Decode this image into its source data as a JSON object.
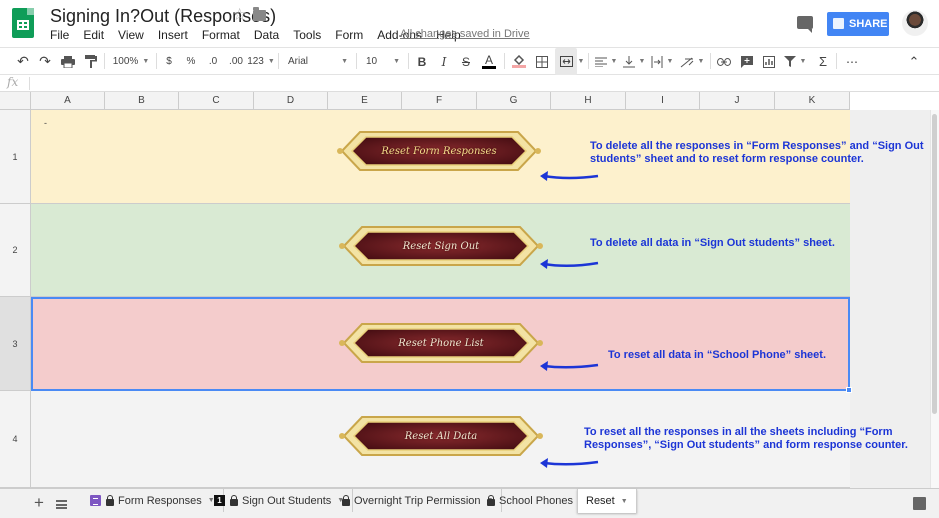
{
  "app": {
    "title": "Signing In?Out (Responses)",
    "saved_status": "All changes saved in Drive",
    "share_label": "SHARE",
    "menu": [
      "File",
      "Edit",
      "View",
      "Insert",
      "Format",
      "Data",
      "Tools",
      "Form",
      "Add-ons",
      "Help"
    ]
  },
  "toolbar": {
    "zoom": "100%",
    "currency": "$",
    "percent": "%",
    "dec_decrease": ".0",
    "dec_increase": ".00",
    "more_formats": "123",
    "font": "Arial",
    "font_size": "10",
    "bold": "B",
    "italic": "I",
    "strike": "S",
    "text_color": "A",
    "sum": "Σ",
    "more": "⋯",
    "collapse": "⌃"
  },
  "formula_bar": {
    "label": "fx",
    "value": ""
  },
  "grid": {
    "columns": [
      "A",
      "B",
      "C",
      "D",
      "E",
      "F",
      "G",
      "H",
      "I",
      "J",
      "K"
    ],
    "rows": [
      "1",
      "2",
      "3",
      "4"
    ],
    "a1_text": "-"
  },
  "buttons": [
    {
      "label": "Reset Form Responses"
    },
    {
      "label": "Reset Sign Out"
    },
    {
      "label": "Reset Phone List"
    },
    {
      "label": "Reset All Data"
    }
  ],
  "notes": [
    {
      "line1": "To delete all the responses in “Form Responses” and “Sign Out",
      "line2": "students” sheet and to reset form response counter."
    },
    {
      "line1": "To delete all data in “Sign Out students” sheet.",
      "line2": ""
    },
    {
      "line1": "To reset all data in “School Phone” sheet.",
      "line2": ""
    },
    {
      "line1": "To reset all the responses in all the sheets including “Form",
      "line2": "Responses”, “Sign Out students” and form response counter."
    }
  ],
  "row_colors": [
    "#fdf1cd",
    "#d9ead3",
    "#f4cccc",
    "#f3f3f3"
  ],
  "tabs": [
    {
      "label": "Form Responses",
      "icon": "form-icon",
      "locked": true
    },
    {
      "label": "Sign Out Students",
      "icon": "badge-1",
      "locked": true
    },
    {
      "label": "Overnight Trip Permission",
      "icon": "none",
      "locked": true
    },
    {
      "label": "School Phones",
      "icon": "none",
      "locked": true
    },
    {
      "label": "Reset",
      "icon": "none",
      "locked": false,
      "active": true
    }
  ],
  "accent": {
    "share": "#4285f4",
    "note_text": "#1c35d6",
    "selection": "#4a8af4",
    "sheets_green": "#0f9d58"
  }
}
